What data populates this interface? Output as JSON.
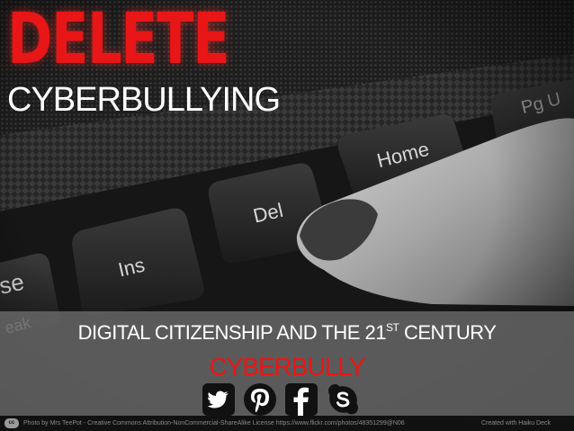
{
  "slide": {
    "title_line1": "DELETE",
    "title_line2": "CYBERBULLYING",
    "subtitle_main": "DIGITAL CITIZENSHIP AND THE 21",
    "subtitle_sup": "ST",
    "subtitle_end": " CENTURY",
    "subtitle_accent": "CYBERBULLY"
  },
  "photo": {
    "keys": [
      "se",
      "Ins",
      "Del",
      "Home",
      "Pg U",
      "eak"
    ]
  },
  "social_icons": [
    "twitter-icon",
    "pinterest-icon",
    "facebook-icon",
    "skype-icon"
  ],
  "footer": {
    "cc_badge": "cc",
    "credit": "Photo by Mrs TeePot - Creative Commons Attribution-NonCommercial-ShareAlike License  https://www.flickr.com/photos/48351299@N06",
    "created_with": "Created with Haiku Deck"
  },
  "colors": {
    "accent_red": "#e81616",
    "banner_gray": "#6e6e6e",
    "text_white": "#ffffff"
  }
}
